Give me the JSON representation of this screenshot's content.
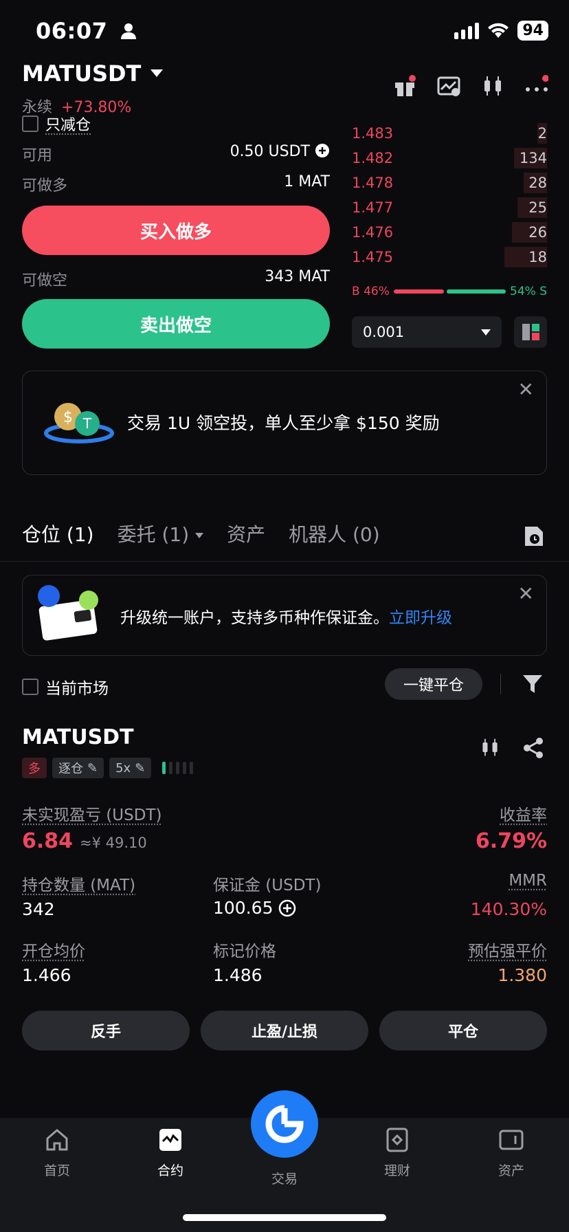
{
  "status_bar": {
    "time": "06:07",
    "battery": "94"
  },
  "header": {
    "pair": "MATUSDT",
    "type": "永续",
    "change": "+73.80%"
  },
  "trade": {
    "reduce_only_label": "只减仓",
    "available_label": "可用",
    "available_value": "0.50 USDT",
    "can_long_label": "可做多",
    "can_long_value": "1 MAT",
    "buy_label": "买入做多",
    "can_short_label": "可做空",
    "can_short_value": "343 MAT",
    "sell_label": "卖出做空"
  },
  "orderbook": {
    "asks": [
      {
        "price": "1.483",
        "qty": "2",
        "depth": 0.05
      },
      {
        "price": "1.482",
        "qty": "134",
        "depth": 0.17
      },
      {
        "price": "1.478",
        "qty": "28",
        "depth": 0.12
      },
      {
        "price": "1.477",
        "qty": "25",
        "depth": 0.15
      },
      {
        "price": "1.476",
        "qty": "26",
        "depth": 0.18
      },
      {
        "price": "1.475",
        "qty": "18",
        "depth": 0.22
      }
    ],
    "buy_ratio": "B 46%",
    "sell_ratio": "54% S",
    "buy_fraction": 0.46,
    "precision": "0.001"
  },
  "promo_banner": {
    "text": "交易 1U 领空投，单人至少拿 $150 奖励"
  },
  "tabs": [
    {
      "label": "仓位 (1)",
      "active": true
    },
    {
      "label": "委托 (1)",
      "active": false
    },
    {
      "label": "资产",
      "active": false
    },
    {
      "label": "机器人 (0)",
      "active": false
    }
  ],
  "upgrade_banner": {
    "text": "升级统一账户，支持多币种作保证金。",
    "link": "立即升级"
  },
  "filter": {
    "current_market_label": "当前市场",
    "close_all_label": "一键平仓"
  },
  "position": {
    "pair": "MATUSDT",
    "side": "多",
    "margin_mode": "逐仓",
    "leverage": "5x",
    "pnl_label": "未实现盈亏 (USDT)",
    "pnl_value": "6.84",
    "pnl_cny": "≈¥ 49.10",
    "roe_label": "收益率",
    "roe_value": "6.79%",
    "size_label": "持仓数量 (MAT)",
    "size_value": "342",
    "margin_label": "保证金 (USDT)",
    "margin_value": "100.65",
    "mmr_label": "MMR",
    "mmr_value": "140.30%",
    "entry_label": "开仓均价",
    "entry_value": "1.466",
    "mark_label": "标记价格",
    "mark_value": "1.486",
    "liq_label": "预估强平价",
    "liq_value": "1.380",
    "reverse_label": "反手",
    "tpsl_label": "止盈/止损",
    "close_label": "平仓"
  },
  "bottom_nav": [
    {
      "label": "首页",
      "icon": "home-icon"
    },
    {
      "label": "合约",
      "icon": "futures-icon"
    },
    {
      "label": "交易",
      "icon": "trade-icon"
    },
    {
      "label": "理财",
      "icon": "finance-icon"
    },
    {
      "label": "资产",
      "icon": "wallet-icon"
    }
  ],
  "colors": {
    "red": "#f0455f",
    "green": "#2cc28b",
    "accent": "#1f7cf7",
    "orange": "#f4a56c"
  }
}
